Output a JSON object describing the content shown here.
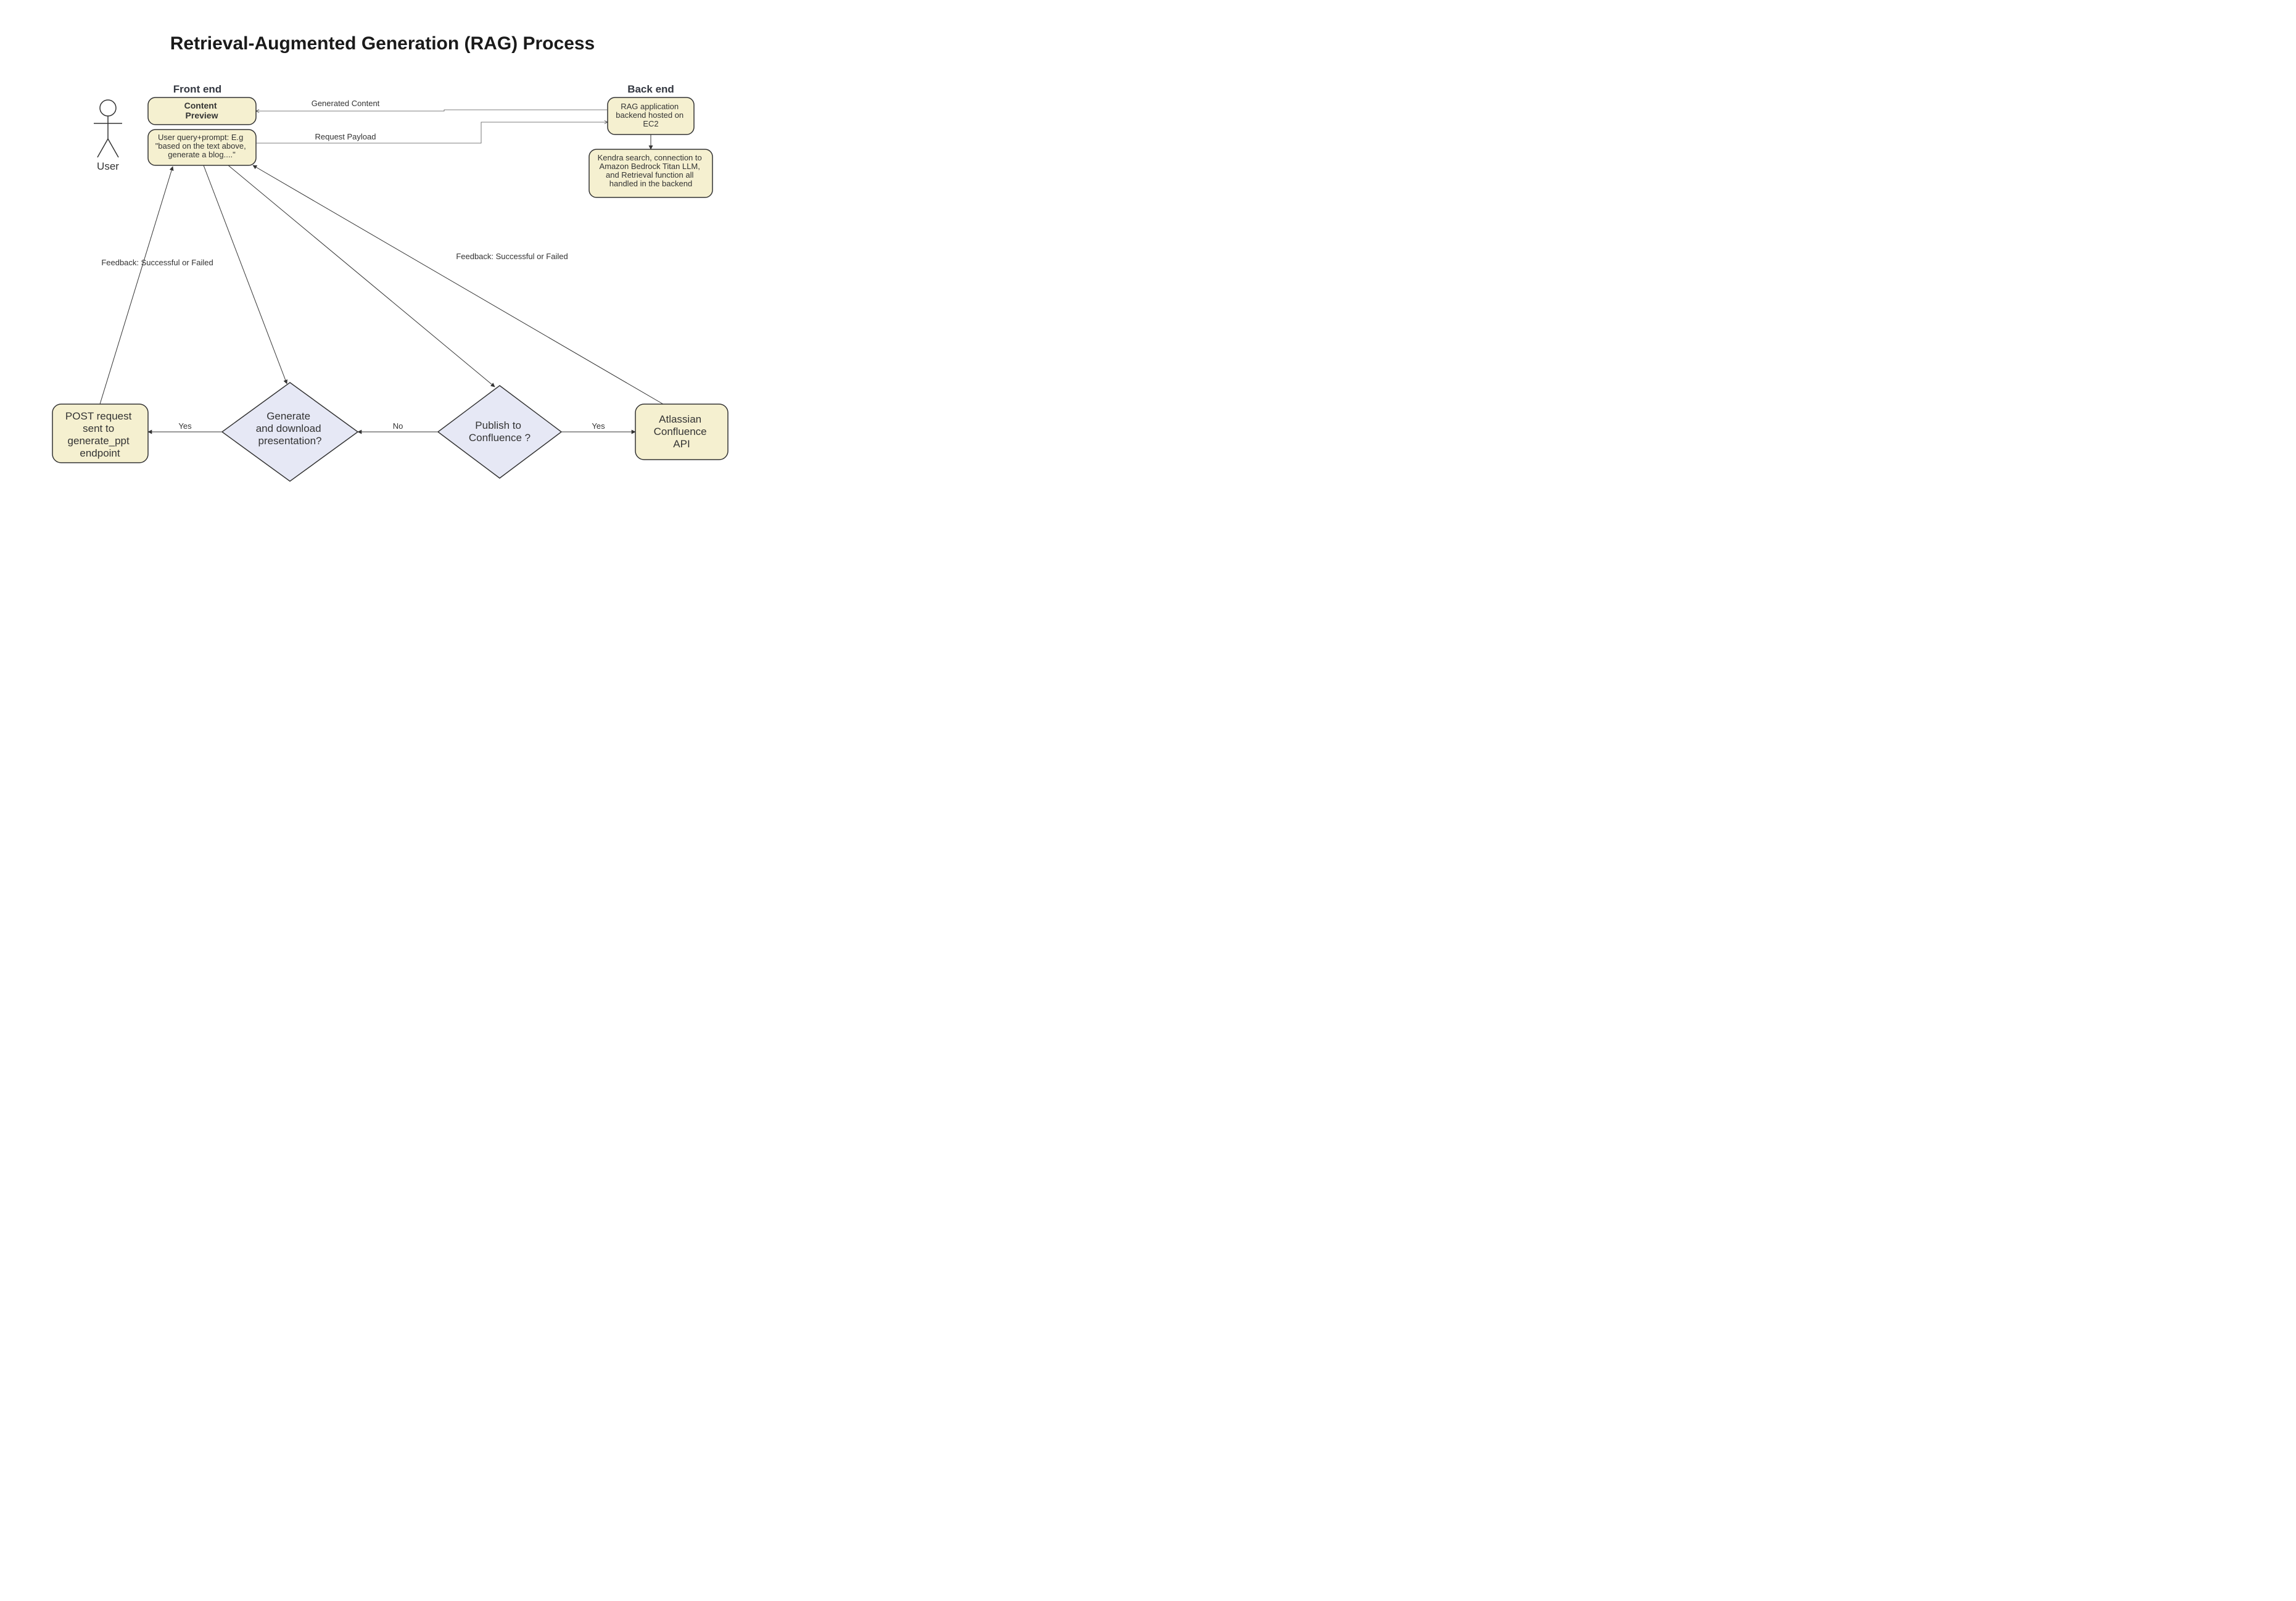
{
  "title": "Retrieval-Augmented Generation (RAG) Process",
  "sections": {
    "frontend": "Front end",
    "backend": "Back end"
  },
  "actors": {
    "user": "User"
  },
  "nodes": {
    "content_preview": "Content\nPreview",
    "user_query": "User query+prompt: E.g\n\"based on the text above,\ngenerate a blog....\"",
    "rag_backend": "RAG application\nbackend hosted on\nEC2",
    "kendra": "Kendra search, connection to\nAmazon Bedrock Titan LLM,\nand Retrieval function all\nhandled in the backend",
    "post_ppt": "POST request\nsent to\ngenerate_ppt\nendpoint",
    "gen_download": "Generate\nand download\npresentation?",
    "publish_conf": "Publish to\nConfluence ?",
    "confluence_api": "Atlassian\nConfluence\nAPI"
  },
  "edges": {
    "generated_content": "Generated Content",
    "request_payload": "Request Payload",
    "feedback_left": "Feedback: Successful or Failed",
    "feedback_right": "Feedback: Successful or Failed",
    "yes_left": "Yes",
    "no_mid": "No",
    "yes_right": "Yes"
  }
}
